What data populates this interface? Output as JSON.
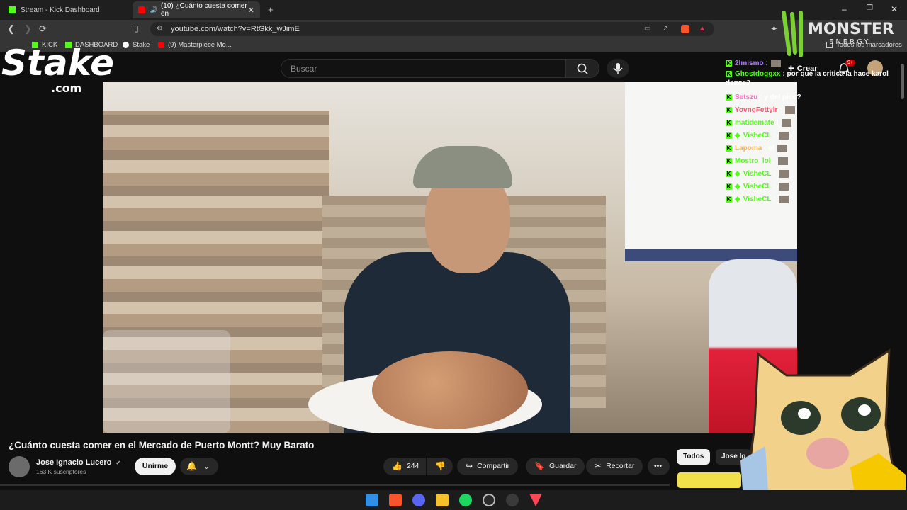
{
  "tabs": [
    {
      "title": "Stream - Kick Dashboard",
      "favicon": "kick-icon",
      "active": false
    },
    {
      "title": "(10) ¿Cuánto cuesta comer en",
      "favicon": "youtube-icon",
      "active": true
    }
  ],
  "new_tab_symbol": "+",
  "url": "youtube.com/watch?v=RtGkk_wJimE",
  "bookmarks": [
    {
      "label": "KICK",
      "icon": "kick-icon"
    },
    {
      "label": "DASHBOARD",
      "icon": "kick-icon"
    },
    {
      "label": "Stake",
      "icon": "stake-icon"
    },
    {
      "label": "(9) Masterpiece Mo...",
      "icon": "youtube-icon"
    }
  ],
  "all_bookmarks_label": "Todos los marcadores",
  "youtube": {
    "search_placeholder": "Buscar",
    "create_label": "Crear",
    "notif_badge": "9+",
    "video_title": "¿Cuánto cuesta comer en el Mercado de Puerto Montt? Muy Barato",
    "channel_name": "Jose Ignacio Lucero",
    "subscribers": "163 K suscriptores",
    "join_label": "Unirme",
    "like_count": "244",
    "share_label": "Compartir",
    "save_label": "Guardar",
    "clip_label": "Recortar",
    "chip_all": "Todos",
    "chip_second": "Jose Ig"
  },
  "chat": [
    {
      "user": "2lmismo",
      "color": "#b07cff",
      "msg": ":",
      "emote": true,
      "badge": false
    },
    {
      "user": "Ghostdoggxx",
      "color": "#53fc18",
      "msg": ": por que la critica la hace karol dance?",
      "emote": false,
      "badge": false
    },
    {
      "user": "Setszu",
      "color": "#ff6ec7",
      "msg": ": y del pico?",
      "emote": false,
      "badge": false
    },
    {
      "user": "YovngFettylr",
      "color": "#ff4f6d",
      "msg": ":",
      "emote": true,
      "badge": false
    },
    {
      "user": "matidemate",
      "color": "#53fc18",
      "msg": ":",
      "emote": true,
      "badge": false
    },
    {
      "user": "VisheCL",
      "color": "#53fc18",
      "msg": ":",
      "emote": true,
      "badge": true
    },
    {
      "user": "Lapoma",
      "color": "#ffb347",
      "msg": ": el",
      "emote": true,
      "badge": false
    },
    {
      "user": "Mostro_lol",
      "color": "#53fc18",
      "msg": ":",
      "emote": true,
      "badge": false
    },
    {
      "user": "VisheCL",
      "color": "#53fc18",
      "msg": ":",
      "emote": true,
      "badge": true
    },
    {
      "user": "VisheCL",
      "color": "#53fc18",
      "msg": ":",
      "emote": true,
      "badge": true
    },
    {
      "user": "VisheCL",
      "color": "#53fc18",
      "msg": ":",
      "emote": true,
      "badge": true
    }
  ],
  "overlays": {
    "stake_logo_text": "Stake",
    "stake_logo_sub": ".com",
    "monster_text": "MONSTER",
    "monster_sub": "ENERGY"
  },
  "taskbar_apps": [
    "windows-icon",
    "brave-icon",
    "discord-icon",
    "explorer-icon",
    "spotify-icon",
    "obs-icon",
    "app-icon",
    "valorant-icon"
  ],
  "colors": {
    "kick_green": "#53fc18",
    "youtube_red": "#ff0000",
    "bg": "#0f0f0f"
  }
}
